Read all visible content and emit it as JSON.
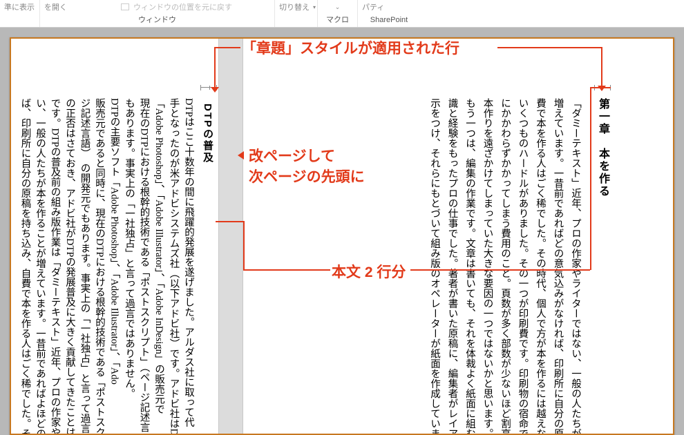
{
  "ribbon": {
    "g1_item": "準に表示",
    "g2_item": "を開く",
    "g2_item2": "ウィンドウの位置を元に戻す",
    "g2_label": "ウィンドウ",
    "g3_item": "切り替え",
    "g4_label": "マクロ",
    "g5_item": "パティ",
    "g5_label": "SharePoint"
  },
  "rightPage": {
    "heading": "第一章　本を作る",
    "lines": [
      "「ダミーテキスト」近年、プロの作家やライターではない、一般の人たちが",
      "増えています。一昔前であればどの意気込みがなければ、印刷所に自分の原稿",
      "費で本を作る人はごく稀でした。その時代、個人で方が本を作るには越えなけ",
      "いくつものハードルがありました。その一つが印刷費です。印刷物の宿命であ",
      "にかかわらずかかってしまう費用のこと。頁数が多く部数が少ないほど割高感",
      "本作りを遠ざかけてしまっていた大きな要因の一つではないかと思います。",
      "もう一つは、編集の作業です。文章は書いても、それを体裁よく紙面に組む",
      "識と経験をもったプロの仕事でした。著者が書いた原稿に、編集者がレイアウ",
      "示をつけ、それらにもとづいて組み版のオペレーターが紙面を作成していまし"
    ]
  },
  "leftPage": {
    "heading": "DTPの普及",
    "lines": [
      "DTPはここ十数年の間に飛躍的発展を遂げました。アルダス社に取って代",
      "手となったのが米アドビシステムズ社（以下アドビ社）です。アドビ社はDT",
      "「Adobe Photoshop」、「Adobe Illustrator」、「Adobe InDesign」の販売元で",
      "現在のDTPにおける根幹的技術である「ポストスクリプト」（ページ記述言",
      "もあります。事実上の「一社独占」と言って過言ではありません。",
      "DTPの主要ソフト「Adobe Photoshop」、「Adobe Illustrator」、「Ado",
      "販売元であると同時に、現在のDTPにおける根幹的技術である「ポストスク",
      "ジ記述言語）　の開発元でもあります。事実上の「一社独占」と言って過言では",
      "の正否はさておき、アドビ社がDTPの発展普及に大きく貢献してきたことは",
      "です。DTPの普及前の組み版作業は「ダミーテキスト」近年、プロの作家や",
      "い、一般の人たちが本を作ることが増えています。一昔前であればよほどの意",
      "ば、印刷所に自分の原稿を持ち込み、自費で本を作る人はごく稀でした。その"
    ]
  },
  "annotations": {
    "a1": "「章題」スタイルが適用された行",
    "a2_l1": "改ページして",
    "a2_l2": "次ページの先頭に",
    "a3": "本文 2 行分"
  }
}
